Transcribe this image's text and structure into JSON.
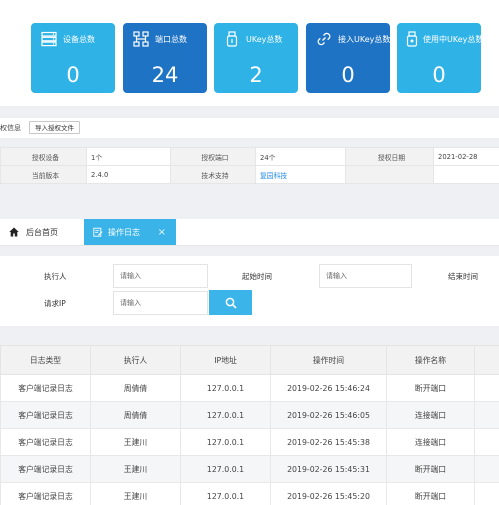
{
  "stats": [
    {
      "title": "设备总数",
      "value": "0",
      "icon": "server-icon",
      "color": "#2fb2e6"
    },
    {
      "title": "端口总数",
      "value": "24",
      "icon": "network-icon",
      "color": "#1e73c5"
    },
    {
      "title": "UKey总数",
      "value": "2",
      "icon": "usb-key-icon",
      "color": "#2fb2e6"
    },
    {
      "title": "接入UKey总数",
      "value": "0",
      "icon": "link-icon",
      "color": "#1e73c5"
    },
    {
      "title": "使用中UKey总数",
      "value": "0",
      "icon": "usb-key-in-use-icon",
      "color": "#2fb2e6"
    }
  ],
  "auth": {
    "title": "权信息",
    "import_label": "导入授权文件",
    "rows": [
      [
        "授权设备",
        "1个",
        "授权端口",
        "24个",
        "授权日期",
        "2021-02-28"
      ],
      [
        "当前版本",
        "2.4.0",
        "技术支持",
        "复园科技",
        "",
        ""
      ]
    ]
  },
  "tabs": {
    "home": "后台首页",
    "active": "操作日志",
    "close": "×"
  },
  "search": {
    "executor_label": "执行人",
    "executor_placeholder": "请输入",
    "start_label": "起始时间",
    "start_placeholder": "请输入",
    "end_label": "结束时间",
    "ip_label": "请求IP",
    "ip_placeholder": "请输入"
  },
  "log": {
    "headers": [
      "日志类型",
      "执行人",
      "IP地址",
      "操作时间",
      "操作名称"
    ],
    "rows": [
      [
        "客户端记录日志",
        "周倩倩",
        "127.0.0.1",
        "2019-02-26 15:46:24",
        "断开端口"
      ],
      [
        "客户端记录日志",
        "周倩倩",
        "127.0.0.1",
        "2019-02-26 15:46:05",
        "连接端口"
      ],
      [
        "客户端记录日志",
        "王建川",
        "127.0.0.1",
        "2019-02-26 15:45:38",
        "连接端口"
      ],
      [
        "客户端记录日志",
        "王建川",
        "127.0.0.1",
        "2019-02-26 15:45:31",
        "断开端口"
      ],
      [
        "客户端记录日志",
        "王建川",
        "127.0.0.1",
        "2019-02-26 15:45:20",
        "断开端口"
      ]
    ]
  }
}
